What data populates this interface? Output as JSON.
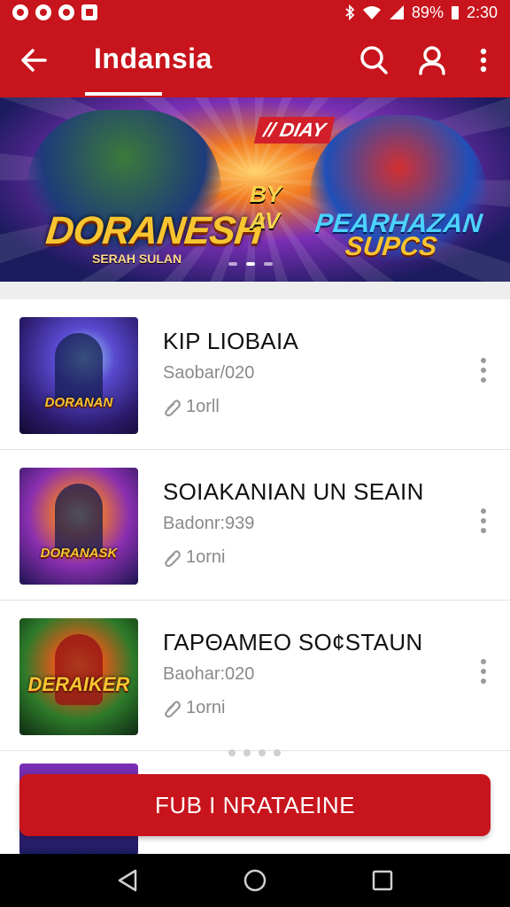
{
  "status_bar": {
    "battery": "89%",
    "time": "2:30"
  },
  "app_bar": {
    "title": "Indansia"
  },
  "banner": {
    "badge": "// DIAY",
    "title_left": "DORANESH",
    "subtitle_left": "SERAH SULAN",
    "by_line1": "BY",
    "by_line2": "AV",
    "title_right_line1": "PEARHAZAN",
    "title_right_line2": "SUPCS"
  },
  "list": {
    "items": [
      {
        "title": "KIP LIOBAIA",
        "subtitle": "Saobar/020",
        "meta": "1orll",
        "thumb_logo": "DORANAN"
      },
      {
        "title": "SOIAKANIAN UN SEAIN",
        "subtitle": "Badonr:939",
        "meta": "1orni",
        "thumb_logo": "DORANASK"
      },
      {
        "title": "ΓΑΡΘΑΜΕΟ SO¢STAUN",
        "subtitle": "Baohar:020",
        "meta": "1orni",
        "thumb_logo": "DERAIKER"
      }
    ]
  },
  "cta": {
    "label": "FUB I NRATAEINE"
  },
  "colors": {
    "brand_red": "#c8141c"
  }
}
